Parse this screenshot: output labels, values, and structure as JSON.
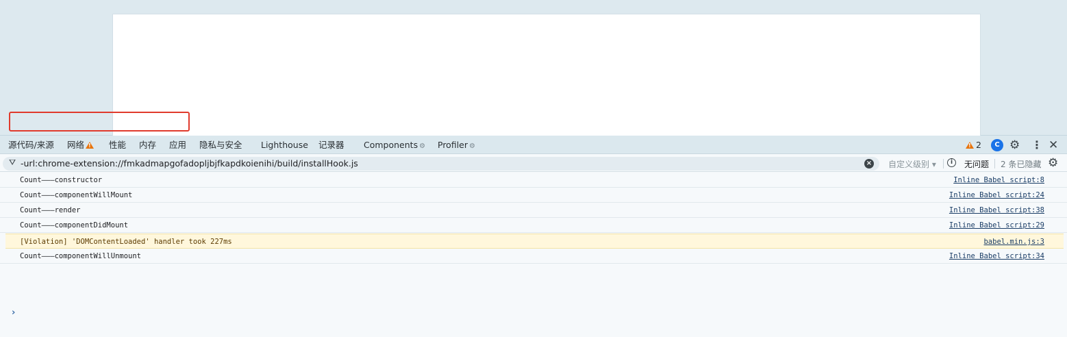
{
  "tabs": [
    {
      "label": "源代码/来源"
    },
    {
      "label": "网络"
    },
    {
      "label": "性能"
    },
    {
      "label": "内存"
    },
    {
      "label": "应用"
    },
    {
      "label": "隐私与安全"
    },
    {
      "label": "Lighthouse"
    },
    {
      "label": "记录器"
    },
    {
      "label": "Components"
    },
    {
      "label": "Profiler"
    }
  ],
  "toolbar_right": {
    "warning_count": "2"
  },
  "filter": {
    "value": "-url:chrome-extension://fmkadmapgofadopljbjfkapdkoienihi/build/installHook.js",
    "level_label": "自定义级别 ▾",
    "issues_label": "无问题",
    "hidden_label": "2 条已隐藏"
  },
  "console": {
    "rows": [
      {
        "message": "Count———constructor",
        "source": "Inline Babel script:8",
        "level": "log"
      },
      {
        "message": "Count———componentWillMount",
        "source": "Inline Babel script:24",
        "level": "log"
      },
      {
        "message": "Count———render",
        "source": "Inline Babel script:38",
        "level": "log"
      },
      {
        "message": "Count———componentDidMount",
        "source": "Inline Babel script:29",
        "level": "log"
      },
      {
        "message": "[Violation] 'DOMContentLoaded' handler took 227ms",
        "source": "babel.min.js:3",
        "level": "warning"
      },
      {
        "message": "Count———componentWillUnmount",
        "source": "Inline Babel script:34",
        "level": "log"
      }
    ],
    "prompt": "›"
  },
  "colors": {
    "highlight": "#e03a2c",
    "warning": "#e8740c",
    "accent": "#1a73e8"
  }
}
